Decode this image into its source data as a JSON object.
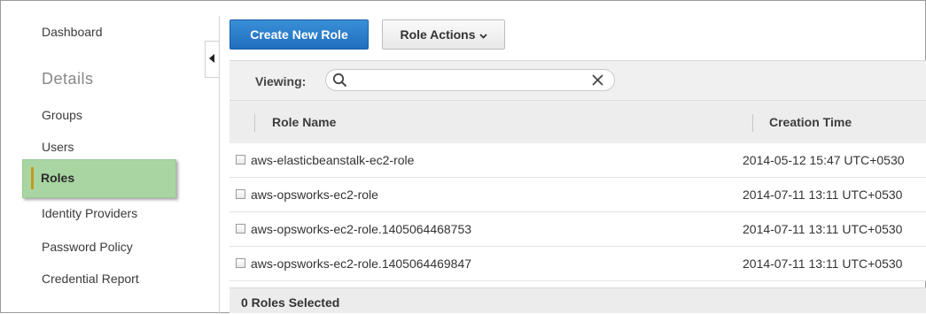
{
  "sidebar": {
    "dashboard": "Dashboard",
    "section_heading": "Details",
    "items": [
      {
        "label": "Groups"
      },
      {
        "label": "Users"
      },
      {
        "label": "Roles"
      },
      {
        "label": "Identity Providers"
      },
      {
        "label": "Password Policy"
      },
      {
        "label": "Credential Report"
      }
    ],
    "active_item": "Roles"
  },
  "toolbar": {
    "create_label": "Create New Role",
    "actions_label": "Role Actions"
  },
  "filter": {
    "viewing_label": "Viewing:",
    "search_value": "",
    "search_placeholder": ""
  },
  "table": {
    "columns": [
      "Role Name",
      "Creation Time"
    ],
    "rows": [
      {
        "name": "aws-elasticbeanstalk-ec2-role",
        "created": "2014-05-12 15:47 UTC+0530"
      },
      {
        "name": "aws-opsworks-ec2-role",
        "created": "2014-07-11 13:11 UTC+0530"
      },
      {
        "name": "aws-opsworks-ec2-role.1405064468753",
        "created": "2014-07-11 13:11 UTC+0530"
      },
      {
        "name": "aws-opsworks-ec2-role.1405064469847",
        "created": "2014-07-11 13:11 UTC+0530"
      }
    ],
    "selection_status": "0 Roles Selected"
  },
  "colors": {
    "primary_button": "#1f6fbf",
    "active_nav_bg": "#a8d5a2",
    "active_nav_marker": "#c19b1f"
  }
}
